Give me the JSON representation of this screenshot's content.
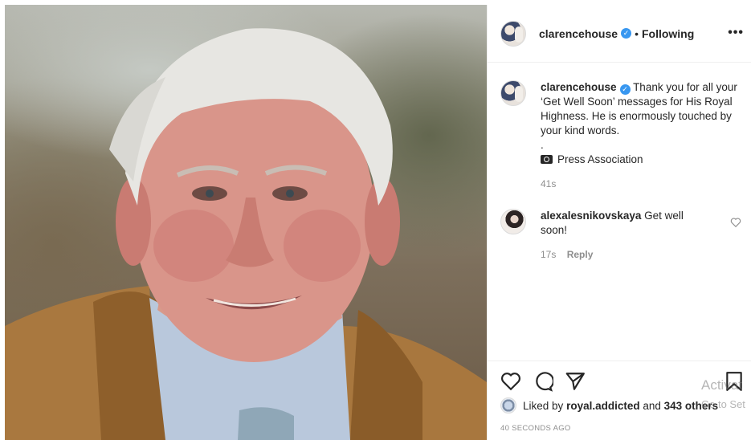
{
  "post": {
    "username": "clarencehouse",
    "separator": "•",
    "follow_status": "Following",
    "more_icon": "more-options-icon"
  },
  "caption": {
    "username": "clarencehouse",
    "text": "Thank you for all your ‘Get Well Soon’ messages for His Royal Highness. He is enormously touched by your kind words.",
    "dot_line": ".",
    "credit": "Press Association",
    "time": "41s"
  },
  "comment": {
    "username": "alexalesnikovskaya",
    "text": "Get well soon!",
    "time": "17s",
    "reply_label": "Reply"
  },
  "footer": {
    "liked_by_prefix": "Liked by",
    "liked_by_user": "royal.addicted",
    "and_word": "and",
    "others": "343 others",
    "timestamp": "40 SECONDS AGO"
  },
  "overlay": {
    "line1": "Activat",
    "line2": "Go to Set"
  },
  "colors": {
    "accent_verified": "#3897f0",
    "text": "#262626",
    "muted": "#8e8e8e"
  }
}
